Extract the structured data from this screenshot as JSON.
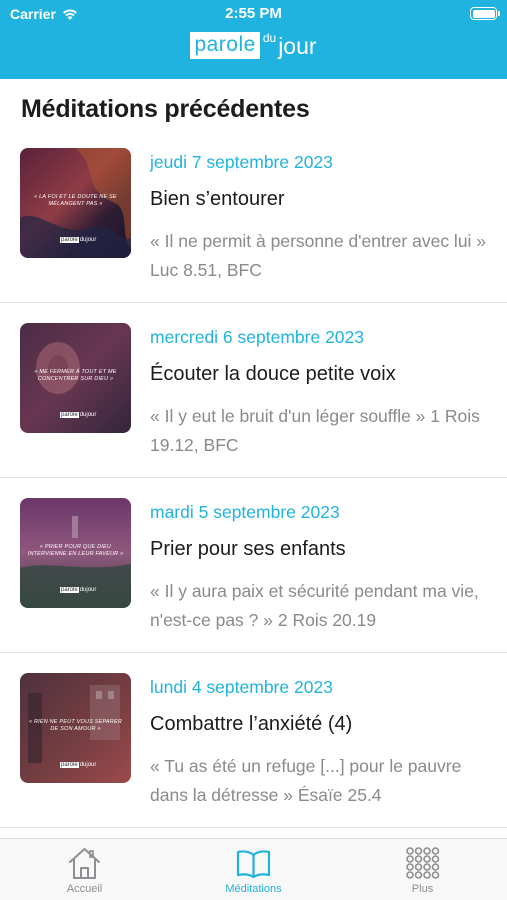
{
  "status_bar": {
    "carrier": "Carrier",
    "time": "2:55 PM"
  },
  "header": {
    "logo_parole": "parole",
    "logo_du": "du",
    "logo_jour": "jour",
    "brand_color": "#20b3e0"
  },
  "page_title": "Méditations précédentes",
  "meditations": [
    {
      "date": "jeudi 7 septembre 2023",
      "title": "Bien s’entourer",
      "verse": "« Il ne permit à personne d'entrer avec lui » Luc 8.51, BFC",
      "thumb_caption": "« LA FOI ET LE DOUTE NE SE MÉLANGENT PAS »"
    },
    {
      "date": "mercredi 6 septembre 2023",
      "title": "Écouter la douce petite voix",
      "verse": "« Il y eut le bruit d'un léger souffle » 1 Rois 19.12, BFC",
      "thumb_caption": "« ME FERMER À TOUT ET ME CONCENTRER SUR DIEU »"
    },
    {
      "date": "mardi 5 septembre 2023",
      "title": "Prier pour ses enfants",
      "verse": "« Il y aura paix et sécurité pendant ma vie, n'est-ce pas ? » 2 Rois 20.19",
      "thumb_caption": "« PRIER POUR QUE DIEU INTERVIENNE EN LEUR FAVEUR »"
    },
    {
      "date": "lundi 4 septembre 2023",
      "title": "Combattre l’anxiété (4)",
      "verse": "« Tu as été un refuge [...] pour le pauvre dans la détresse » Ésaïe 25.4",
      "thumb_caption": "« RIEN NE PEUT VOUS SÉPARER DE SON AMOUR »"
    }
  ],
  "thumb_logo": {
    "parole": "parole",
    "rest": "dujour"
  },
  "tabs": [
    {
      "label": "Accueil",
      "icon": "home-icon",
      "active": false
    },
    {
      "label": "Méditations",
      "icon": "book-icon",
      "active": true
    },
    {
      "label": "Plus",
      "icon": "grid-dots-icon",
      "active": false
    }
  ]
}
